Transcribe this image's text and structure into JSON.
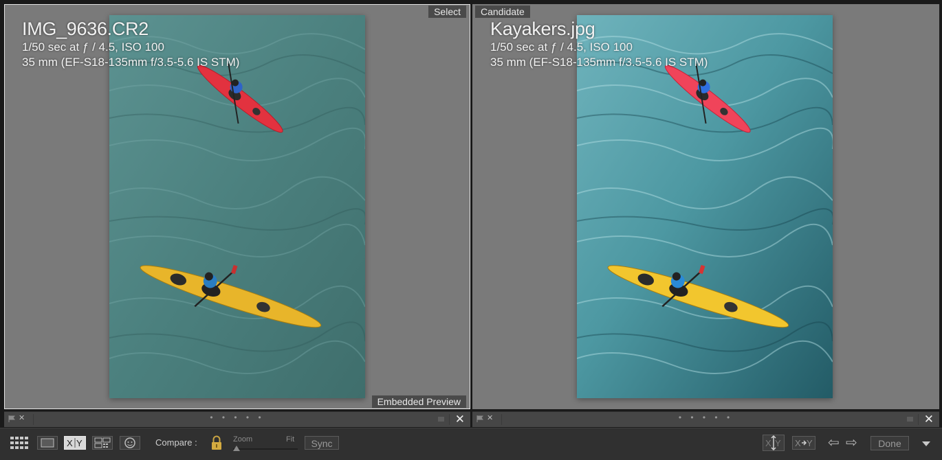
{
  "left_pane": {
    "filename": "IMG_9636.CR2",
    "exposure": "1/50 sec at ƒ / 4.5, ISO 100",
    "lens": "35 mm (EF-S18-135mm f/3.5-5.6 IS STM)",
    "label": "Select",
    "preview_badge": "Embedded Preview"
  },
  "right_pane": {
    "filename": "Kayakers.jpg",
    "exposure": "1/50 sec at ƒ / 4.5, ISO 100",
    "lens": "35 mm (EF-S18-135mm f/3.5-5.6 IS STM)",
    "label": "Candidate"
  },
  "strips": {
    "dots": "• • • • •",
    "close": "✕",
    "reject": "✕"
  },
  "toolbar": {
    "compare_label": "Compare :",
    "zoom_label": "Zoom",
    "fit_label": "Fit",
    "sync_label": "Sync",
    "done_label": "Done",
    "prev_arrow": "⇦",
    "next_arrow": "⇨",
    "zoom_level": 0.05,
    "icons": [
      "grid-view-icon",
      "loupe-view-icon",
      "compare-view-icon",
      "survey-view-icon",
      "people-view-icon",
      "lock-icon",
      "swap-icon",
      "make-select-icon",
      "dropdown-caret-icon"
    ]
  },
  "colors": {
    "pane_background": "#7a7a7a",
    "toolbar_background": "#303030",
    "selected_outline": "#e6e6e6",
    "water_left": "#4f8583",
    "water_right": "#3f8e98",
    "red_kayak": "#e2323f",
    "yellow_kayak": "#e8b52a"
  }
}
